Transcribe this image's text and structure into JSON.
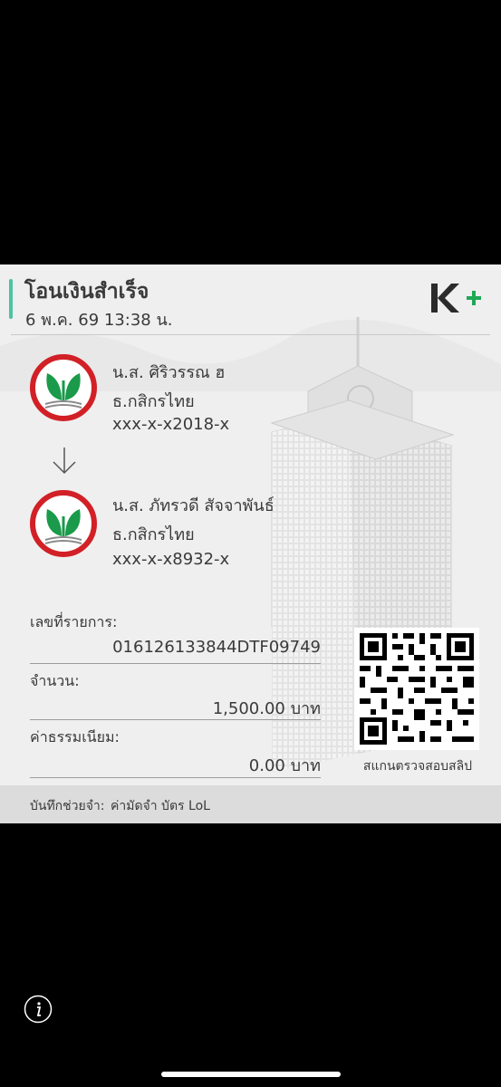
{
  "slip": {
    "title": "โอนเงินสำเร็จ",
    "datetime": "6 พ.ค. 69  13:38 น.",
    "sender": {
      "name": "น.ส. ศิริวรรณ ฮ",
      "bank": "ธ.กสิกรไทย",
      "account": "xxx-x-x2018-x"
    },
    "receiver": {
      "name": "น.ส. ภัทรวดี สัจจาพันธ์",
      "bank": "ธ.กสิกรไทย",
      "account": "xxx-x-x8932-x"
    },
    "reference_label": "เลขที่รายการ:",
    "reference_value": "016126133844DTF09749",
    "amount_label": "จำนวน:",
    "amount_value": "1,500.00 บาท",
    "fee_label": "ค่าธรรมเนียม:",
    "fee_value": "0.00 บาท",
    "qr_caption": "สแกนตรวจสอบสลิป",
    "memo_label": "บันทึกช่วยจำ:",
    "memo_value": "ค่ามัดจำ บัตร LoL"
  },
  "icons": {
    "app_logo": "kplus-logo",
    "bank_logo": "kasikorn-bank-logo",
    "arrow": "arrow-down-icon",
    "qr": "qr-code",
    "info": "info-icon"
  },
  "colors": {
    "accent": "#4fc3a1",
    "brand_dark": "#2b2b2b",
    "brand_green": "#1fa855",
    "bank_red": "#d22027",
    "bank_green": "#1a9a4a"
  }
}
